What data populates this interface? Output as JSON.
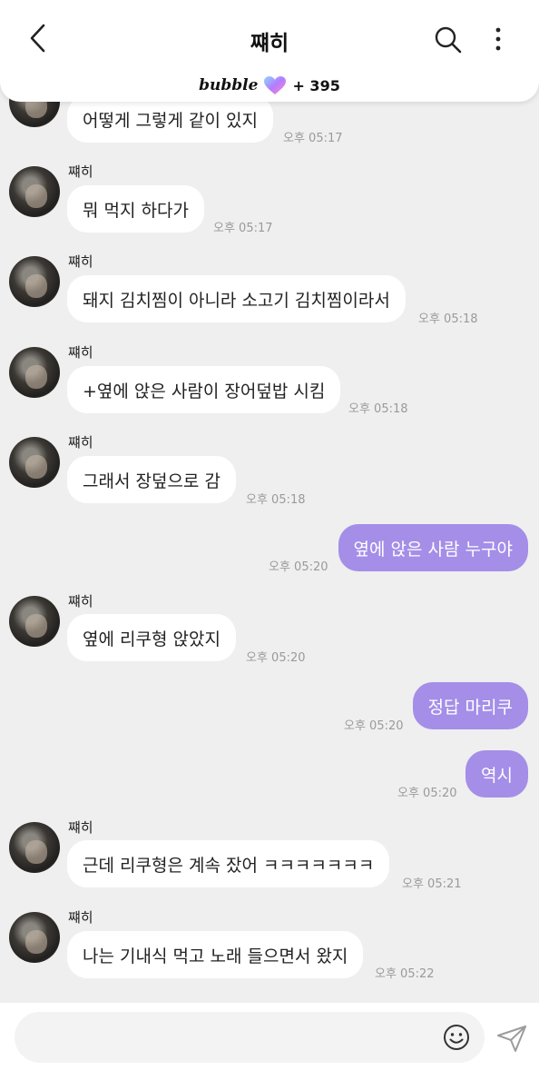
{
  "header": {
    "title": "쨰히",
    "bubble_brand": "bubble",
    "bubble_count": "+ 395",
    "back_icon": "chevron-left",
    "search_icon": "magnifier",
    "more_icon": "vertical-ellipsis",
    "heart_icon": "gradient-heart"
  },
  "colors": {
    "outgoing_bubble": "#a48ee8",
    "incoming_bubble": "#ffffff",
    "background": "#efefef",
    "heart_gradient": [
      "#8ad8ff",
      "#b57bff",
      "#ff8ac8"
    ]
  },
  "messages": [
    {
      "direction": "in",
      "show_sender": false,
      "sender": "",
      "text": "어떻게 그렇게 같이 있지",
      "time": "오후 05:17"
    },
    {
      "direction": "in",
      "show_sender": true,
      "sender": "쨰히",
      "text": "뭐 먹지 하다가",
      "time": "오후 05:17"
    },
    {
      "direction": "in",
      "show_sender": true,
      "sender": "쨰히",
      "text": "돼지 김치찜이 아니라 소고기 김치찜이라서",
      "time": "오후 05:18"
    },
    {
      "direction": "in",
      "show_sender": true,
      "sender": "쨰히",
      "text": "+옆에 앉은 사람이 장어덮밥 시킴",
      "time": "오후 05:18"
    },
    {
      "direction": "in",
      "show_sender": true,
      "sender": "쨰히",
      "text": "그래서 장덮으로 감",
      "time": "오후 05:18"
    },
    {
      "direction": "out",
      "text": "옆에 앉은 사람 누구야",
      "time": "오후 05:20"
    },
    {
      "direction": "in",
      "show_sender": true,
      "sender": "쨰히",
      "text": "옆에 리쿠형 앉았지",
      "time": "오후 05:20"
    },
    {
      "direction": "out",
      "text": "정답 마리쿠",
      "time": "오후 05:20"
    },
    {
      "direction": "out",
      "text": "역시",
      "time": "오후 05:20"
    },
    {
      "direction": "in",
      "show_sender": true,
      "sender": "쨰히",
      "text": "근데 리쿠형은 계속 잤어 ㅋㅋㅋㅋㅋㅋㅋ",
      "time": "오후 05:21"
    },
    {
      "direction": "in",
      "show_sender": true,
      "sender": "쨰히",
      "text": "나는 기내식 먹고 노래 들으면서 왔지",
      "time": "오후 05:22"
    }
  ],
  "composer": {
    "value": "",
    "emoji_icon": "smiley-face",
    "send_icon": "paper-plane"
  }
}
